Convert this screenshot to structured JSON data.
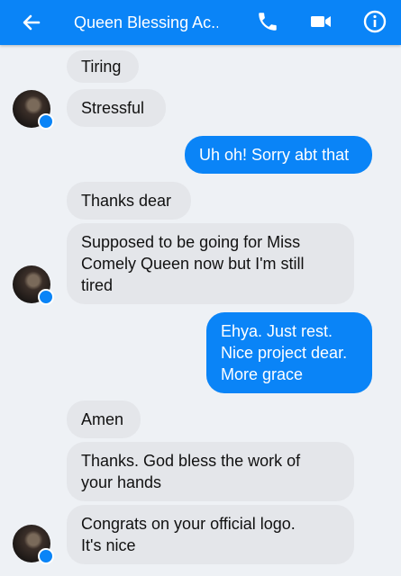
{
  "header": {
    "title": "Queen Blessing Ac...",
    "color": "#0a84f7"
  },
  "messages": [
    {
      "text": "Tiring",
      "dir": "in"
    },
    {
      "text": "Stressful",
      "dir": "in"
    },
    {
      "text": "Uh oh! Sorry abt that",
      "dir": "out"
    },
    {
      "text": "Thanks dear",
      "dir": "in"
    },
    {
      "text": "Supposed to be going for Miss\nComely Queen now but I'm still\ntired",
      "dir": "in"
    },
    {
      "text": "Ehya. Just rest.\nNice project dear.\nMore grace",
      "dir": "out"
    },
    {
      "text": "Amen",
      "dir": "in"
    },
    {
      "text": "Thanks. God bless the work of\nyour hands",
      "dir": "in"
    },
    {
      "text": "Congrats on your official logo.\nIt's nice",
      "dir": "in"
    }
  ]
}
